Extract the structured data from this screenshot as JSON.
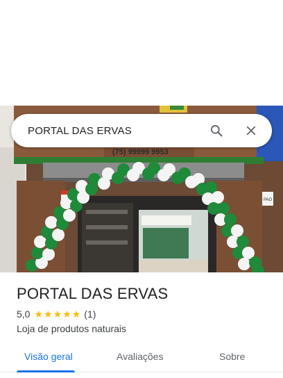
{
  "search": {
    "query": "PORTAL DAS ERVAS",
    "search_icon": "search-icon",
    "clear_icon": "close-icon"
  },
  "photo": {
    "sign_phone": "(75) 99999 9953",
    "side_sign": "PAO"
  },
  "place": {
    "name": "PORTAL DAS ERVAS",
    "rating": "5,0",
    "stars": 5,
    "review_count": "(1)",
    "category": "Loja de produtos naturais"
  },
  "tabs": [
    {
      "label": "Visão geral",
      "active": true
    },
    {
      "label": "Avaliações",
      "active": false
    },
    {
      "label": "Sobre",
      "active": false
    }
  ],
  "colors": {
    "accent": "#1a73e8",
    "star": "#fbbc04",
    "balloon_green": "#1e8a3a",
    "balloon_white": "#f4f4f4"
  }
}
